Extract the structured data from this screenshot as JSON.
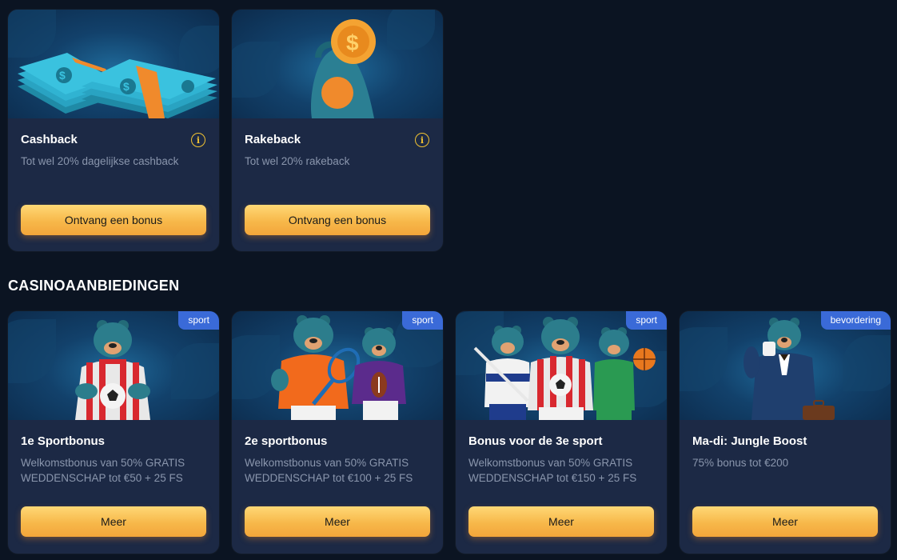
{
  "cards_top": [
    {
      "title": "Cashback",
      "desc": "Tot wel 20% dagelijkse cashback",
      "button": "Ontvang een bonus",
      "icon": "info-icon"
    },
    {
      "title": "Rakeback",
      "desc": "Tot wel 20% rakeback",
      "button": "Ontvang een bonus",
      "icon": "info-icon"
    }
  ],
  "section_title": "CASINOAANBIEDINGEN",
  "offers": [
    {
      "badge": "sport",
      "title": "1e Sportbonus",
      "desc": "Welkomstbonus van 50% GRATIS WEDDENSCHAP tot €50 + 25 FS",
      "button": "Meer"
    },
    {
      "badge": "sport",
      "title": "2e sportbonus",
      "desc": "Welkomstbonus van 50% GRATIS WEDDENSCHAP tot €100 + 25 FS",
      "button": "Meer"
    },
    {
      "badge": "sport",
      "title": "Bonus voor de 3e sport",
      "desc": "Welkomstbonus van 50% GRATIS WEDDENSCHAP tot €150 + 25 FS",
      "button": "Meer"
    },
    {
      "badge": "bevordering",
      "title": "Ma-di: Jungle Boost",
      "desc": "75% bonus tot €200",
      "button": "Meer"
    }
  ],
  "colors": {
    "background": "#0b1422",
    "card": "#1c2945",
    "badge": "#3a6ad8",
    "button": "#f7b84a",
    "info": "#f1c232"
  }
}
